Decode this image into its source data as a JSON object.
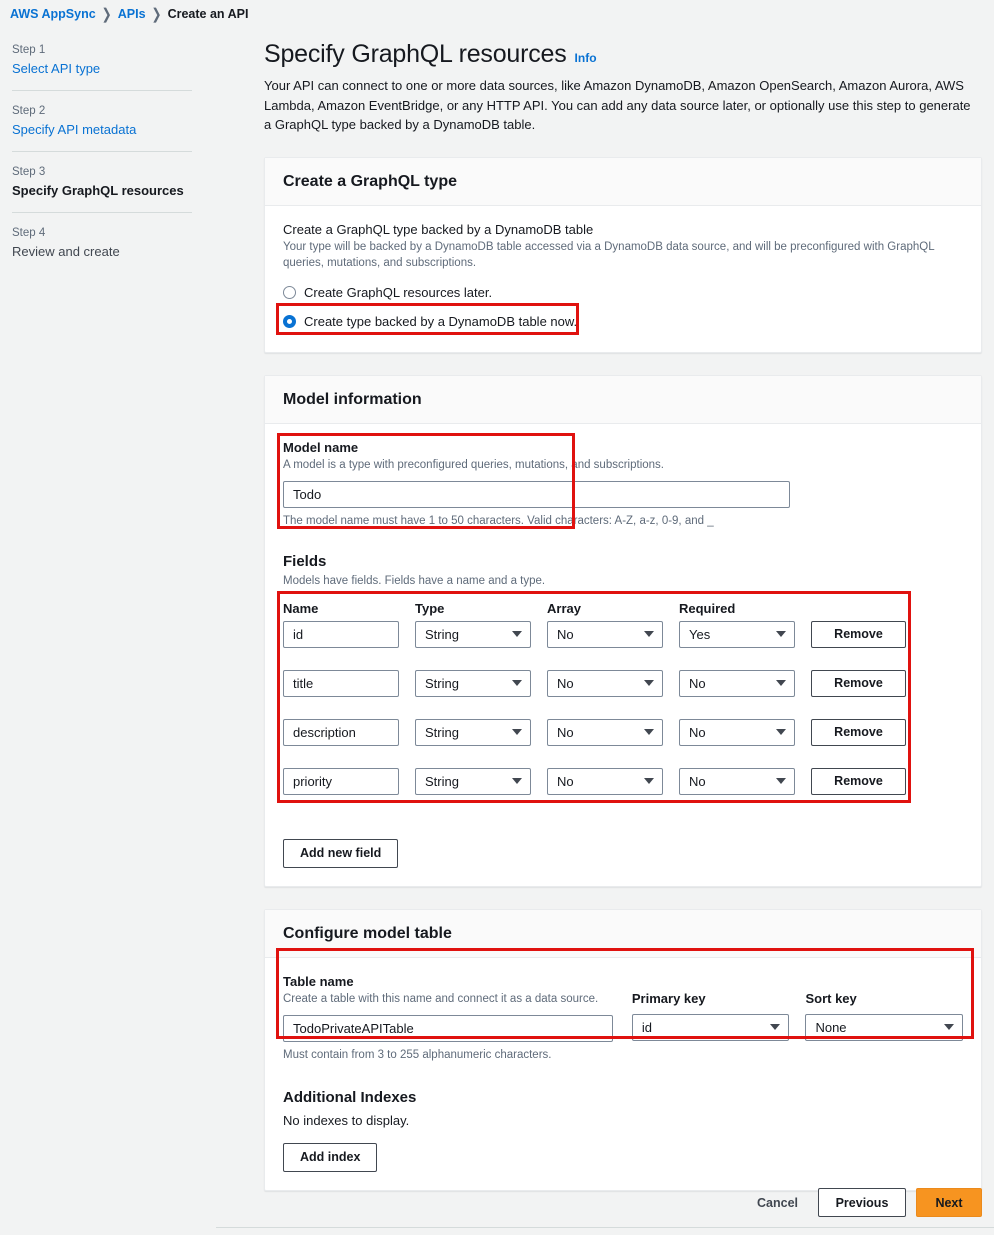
{
  "breadcrumb": {
    "items": [
      {
        "label": "AWS AppSync",
        "link": true
      },
      {
        "label": "APIs",
        "link": true
      },
      {
        "label": "Create an API",
        "link": false
      }
    ],
    "separator": "❯"
  },
  "wizard": {
    "steps": [
      {
        "number": "Step 1",
        "label": "Select API type",
        "state": "link"
      },
      {
        "number": "Step 2",
        "label": "Specify API metadata",
        "state": "link"
      },
      {
        "number": "Step 3",
        "label": "Specify GraphQL resources",
        "state": "current"
      },
      {
        "number": "Step 4",
        "label": "Review and create",
        "state": "pending"
      }
    ]
  },
  "header": {
    "title": "Specify GraphQL resources",
    "info_label": "Info",
    "description": "Your API can connect to one or more data sources, like Amazon DynamoDB, Amazon OpenSearch, Amazon Aurora, AWS Lambda, Amazon EventBridge, or any HTTP API. You can add any data source later, or optionally use this step to generate a GraphQL type backed by a DynamoDB table."
  },
  "create_type_card": {
    "title": "Create a GraphQL type",
    "section_label": "Create a GraphQL type backed by a DynamoDB table",
    "section_hint": "Your type will be backed by a DynamoDB table accessed via a DynamoDB data source, and will be preconfigured with GraphQL queries, mutations, and subscriptions.",
    "options": [
      {
        "label": "Create GraphQL resources later.",
        "selected": false
      },
      {
        "label": "Create type backed by a DynamoDB table now.",
        "selected": true
      }
    ]
  },
  "model_information_card": {
    "title": "Model information",
    "model_name": {
      "label": "Model name",
      "hint": "A model is a type with preconfigured queries, mutations, and subscriptions.",
      "value": "Todo",
      "constraint": "The model name must have 1 to 50 characters. Valid characters: A-Z, a-z, 0-9, and _"
    },
    "fields": {
      "heading": "Fields",
      "hint": "Models have fields. Fields have a name and a type.",
      "columns": [
        "Name",
        "Type",
        "Array",
        "Required"
      ],
      "remove_label": "Remove",
      "rows": [
        {
          "name": "id",
          "type": "String",
          "array": "No",
          "required": "Yes"
        },
        {
          "name": "title",
          "type": "String",
          "array": "No",
          "required": "No"
        },
        {
          "name": "description",
          "type": "String",
          "array": "No",
          "required": "No"
        },
        {
          "name": "priority",
          "type": "String",
          "array": "No",
          "required": "No"
        }
      ],
      "add_field_label": "Add new field"
    }
  },
  "configure_model_table_card": {
    "title": "Configure model table",
    "table_name": {
      "label": "Table name",
      "hint": "Create a table with this name and connect it as a data source.",
      "value": "TodoPrivateAPITable",
      "constraint": "Must contain from 3 to 255 alphanumeric characters."
    },
    "primary_key": {
      "label": "Primary key",
      "value": "id"
    },
    "sort_key": {
      "label": "Sort key",
      "value": "None"
    },
    "additional_indexes": {
      "heading": "Additional Indexes",
      "empty_text": "No indexes to display.",
      "add_index_label": "Add index"
    }
  },
  "footer": {
    "cancel_label": "Cancel",
    "previous_label": "Previous",
    "next_label": "Next"
  },
  "colors": {
    "link": "#0972d3",
    "primary_button": "#f79420",
    "annotation": "#e0120f",
    "page_background": "#f2f3f3",
    "card_header": "#fafafa"
  }
}
